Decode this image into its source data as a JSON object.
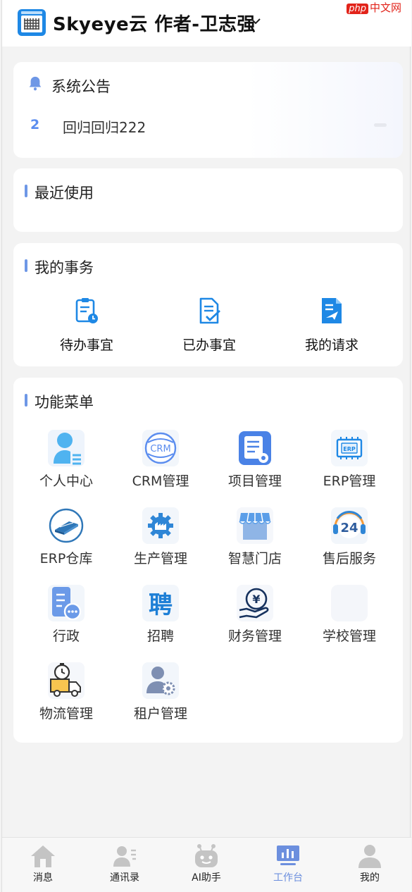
{
  "header": {
    "title": "Skyeye云 作者-卫志强",
    "watermark_brand": "php",
    "watermark_text": "中文网"
  },
  "notice": {
    "title": "系统公告",
    "items": [
      {
        "num": "2",
        "text": "回归回归222"
      }
    ]
  },
  "recent": {
    "title": "最近使用"
  },
  "affairs": {
    "title": "我的事务",
    "items": [
      {
        "label": "待办事宜",
        "icon": "clipboard-clock-icon"
      },
      {
        "label": "已办事宜",
        "icon": "document-check-icon"
      },
      {
        "label": "我的请求",
        "icon": "paper-plane-document-icon"
      }
    ]
  },
  "menu": {
    "title": "功能菜单",
    "items": [
      {
        "label": "个人中心",
        "icon": "person-list-icon"
      },
      {
        "label": "CRM管理",
        "icon": "crm-badge-icon",
        "badge": "CRM"
      },
      {
        "label": "项目管理",
        "icon": "project-clipboard-icon"
      },
      {
        "label": "ERP管理",
        "icon": "erp-chip-icon",
        "badge": "ERP"
      },
      {
        "label": "ERP仓库",
        "icon": "warehouse-box-icon"
      },
      {
        "label": "生产管理",
        "icon": "factory-gear-icon"
      },
      {
        "label": "智慧门店",
        "icon": "store-awning-icon"
      },
      {
        "label": "售后服务",
        "icon": "headset-24-icon",
        "badge": "24"
      },
      {
        "label": "行政",
        "icon": "admin-document-icon"
      },
      {
        "label": "招聘",
        "icon": "recruit-character-icon",
        "badge": "聘"
      },
      {
        "label": "财务管理",
        "icon": "yuan-hand-icon",
        "badge": "¥"
      },
      {
        "label": "学校管理",
        "icon": "school-icon"
      },
      {
        "label": "物流管理",
        "icon": "delivery-truck-icon"
      },
      {
        "label": "租户管理",
        "icon": "tenant-user-gear-icon"
      }
    ]
  },
  "tabbar": {
    "items": [
      {
        "label": "消息",
        "icon": "home-icon",
        "active": false
      },
      {
        "label": "通讯录",
        "icon": "contacts-icon",
        "active": false
      },
      {
        "label": "AI助手",
        "icon": "robot-icon",
        "active": false
      },
      {
        "label": "工作台",
        "icon": "workbench-chart-icon",
        "active": true
      },
      {
        "label": "我的",
        "icon": "profile-icon",
        "active": false
      }
    ]
  },
  "colors": {
    "accent": "#6e97e6",
    "active_tab": "#6c8fde",
    "icon_blue": "#1e88e5"
  }
}
